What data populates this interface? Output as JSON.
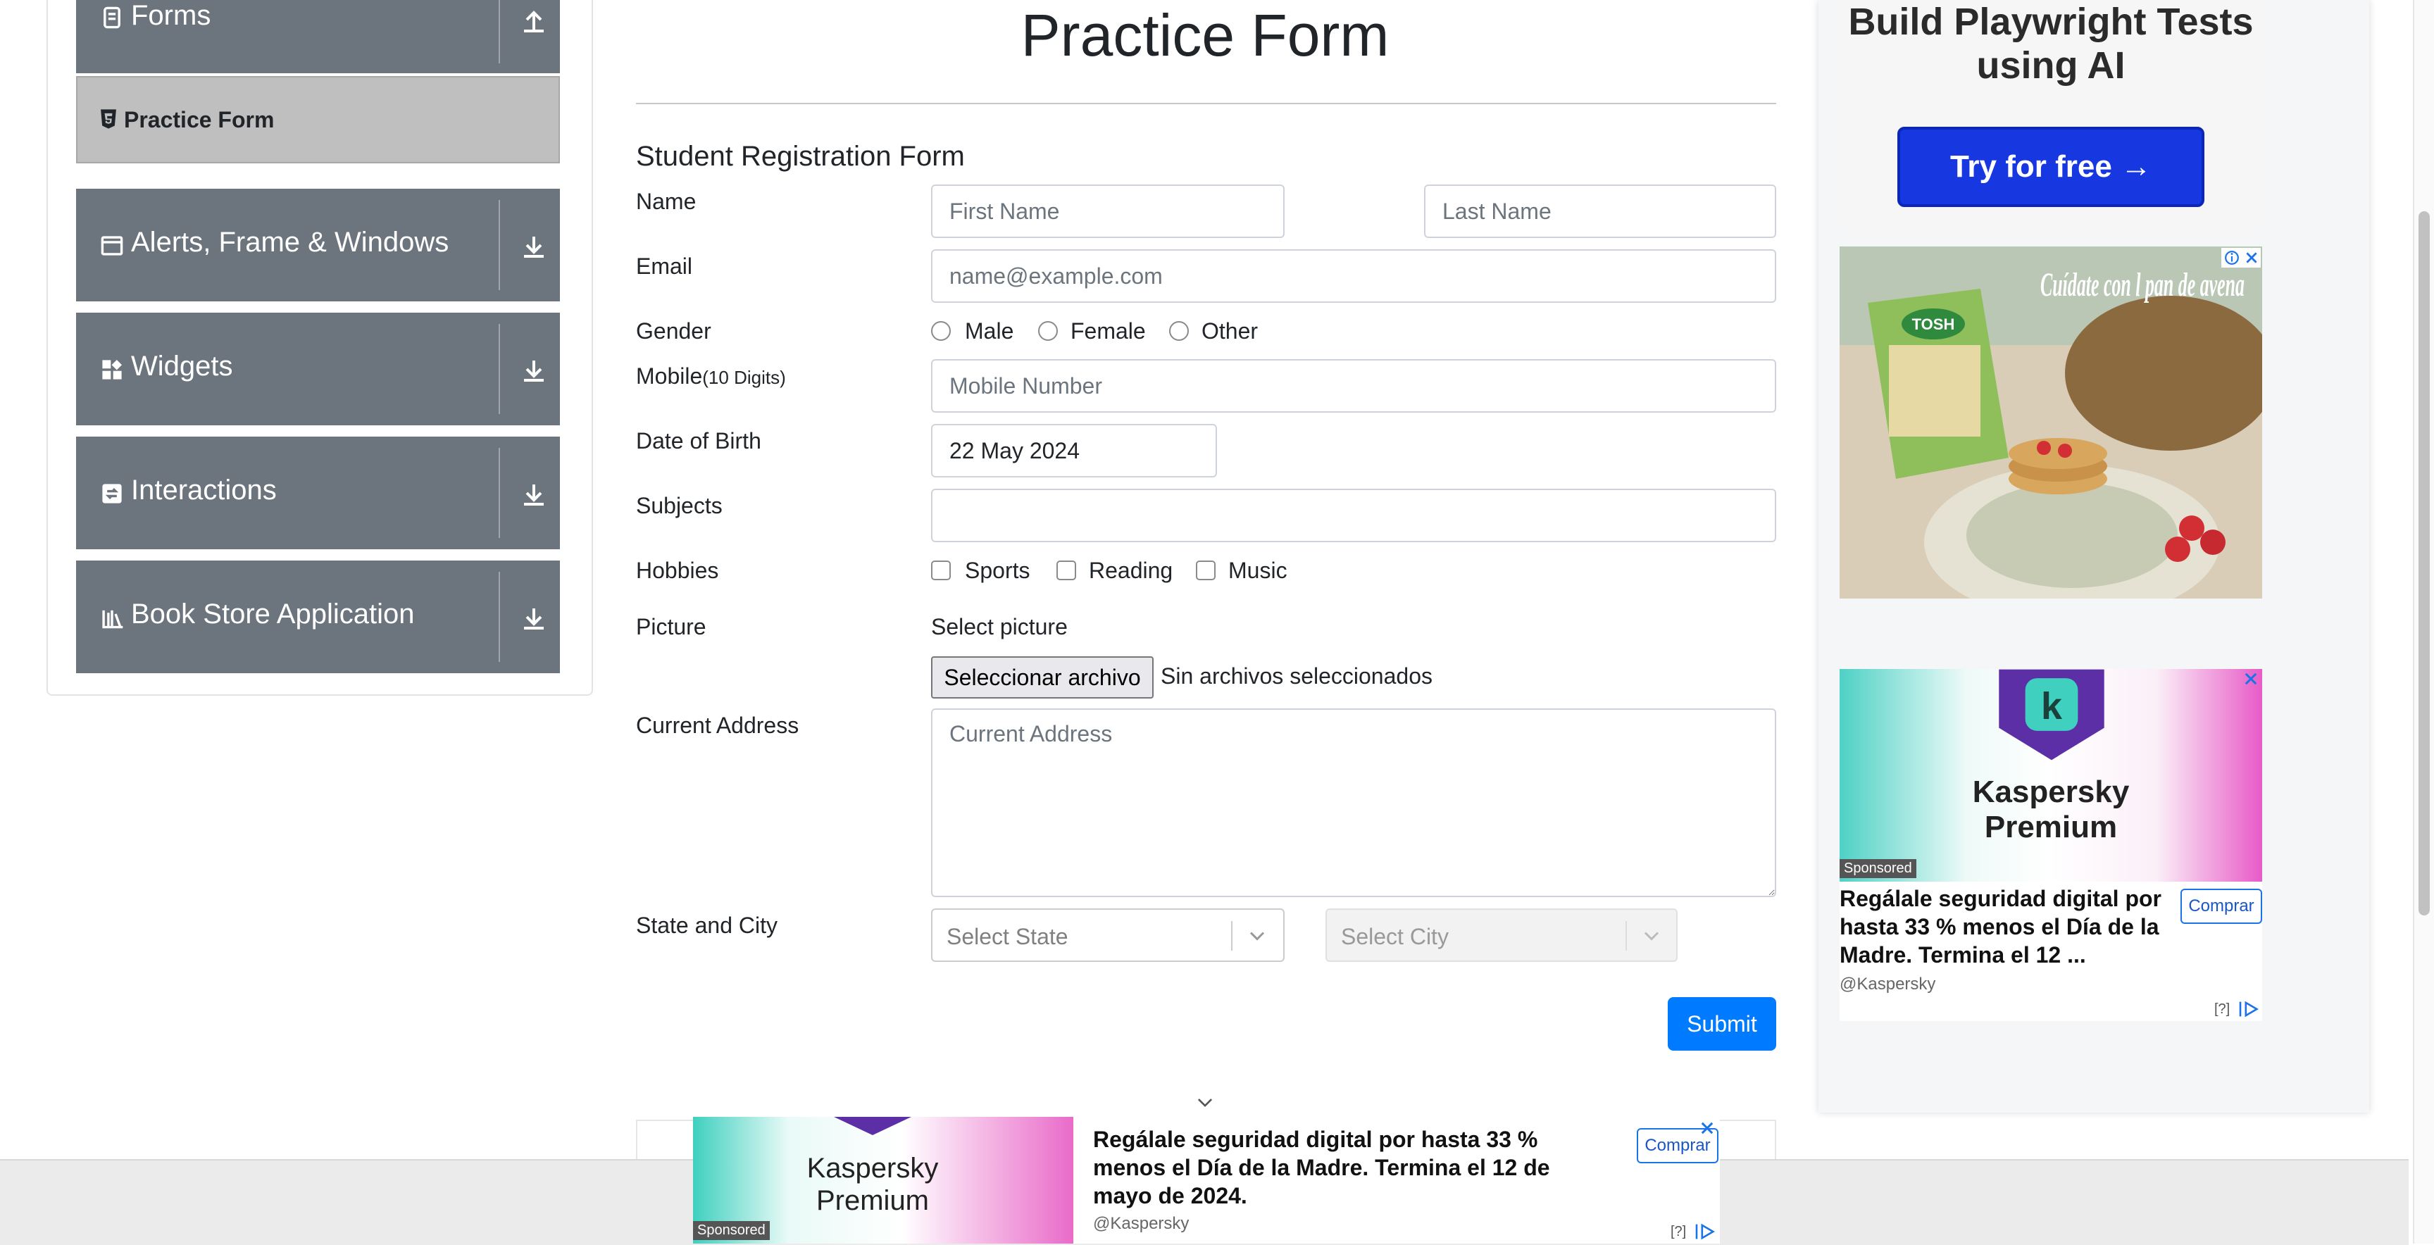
{
  "sidebar": {
    "forms_label": "Forms",
    "practice_form_label": "Practice Form",
    "groups": [
      {
        "label": "Alerts, Frame & Windows",
        "icon": "window-icon"
      },
      {
        "label": "Widgets",
        "icon": "grid-icon"
      },
      {
        "label": "Interactions",
        "icon": "interaction-icon"
      },
      {
        "label": "Book Store Application",
        "icon": "books-icon"
      }
    ]
  },
  "main": {
    "title": "Practice Form",
    "form_heading": "Student Registration Form",
    "labels": {
      "name": "Name",
      "email": "Email",
      "gender": "Gender",
      "mobile": "Mobile",
      "mobile_hint": "(10 Digits)",
      "dob": "Date of Birth",
      "subjects": "Subjects",
      "hobbies": "Hobbies",
      "picture": "Picture",
      "address": "Current Address",
      "state_city": "State and City"
    },
    "placeholders": {
      "first_name": "First Name",
      "last_name": "Last Name",
      "email": "name@example.com",
      "mobile": "Mobile Number",
      "address": "Current Address"
    },
    "dob_value": "22 May 2024",
    "gender_options": [
      "Male",
      "Female",
      "Other"
    ],
    "hobby_options": [
      "Sports",
      "Reading",
      "Music"
    ],
    "picture": {
      "select_text": "Select picture",
      "file_button": "Seleccionar archivo",
      "no_file": "Sin archivos seleccionados"
    },
    "state_placeholder": "Select State",
    "city_placeholder": "Select City",
    "submit_label": "Submit"
  },
  "ads": {
    "playwright": {
      "headline": "Build Playwright Tests using AI",
      "cta": "Try for free →"
    },
    "food": {
      "brand_text": "Cuídate con l pan de avena",
      "pack_text": "TOSH"
    },
    "kaspersky": {
      "brand": "Kaspersky Premium",
      "logo_letter": "k",
      "sponsored": "Sponsored",
      "headline": "Regálale seguridad digital por hasta 33 % menos el Día de la Madre. Termina el 12 ...",
      "handle": "@Kaspersky",
      "buy": "Comprar",
      "adchoice": "[?]"
    },
    "bottom": {
      "brand": "Kaspersky Premium",
      "sponsored": "Sponsored",
      "headline": "Regálale seguridad digital por hasta 33 % menos el Día de la Madre. Termina el 12 de mayo de 2024.",
      "handle": "@Kaspersky",
      "buy": "Comprar",
      "adchoice": "[?]"
    }
  },
  "colors": {
    "sidebar_group": "#6c757d",
    "active_item": "#bfbfbf",
    "submit": "#007bff",
    "ad_cta": "#1738e0"
  }
}
